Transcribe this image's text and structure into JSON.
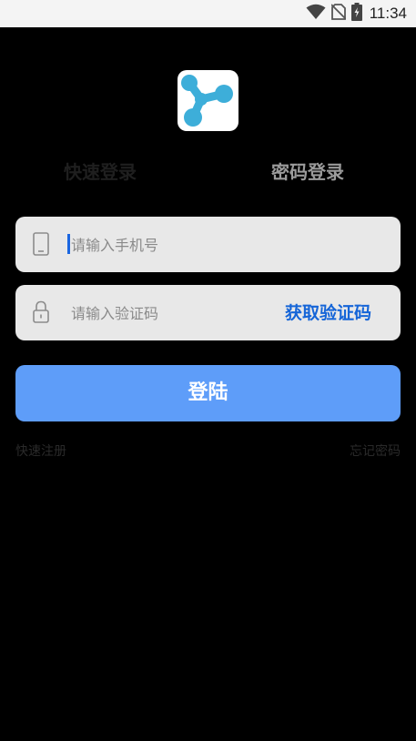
{
  "status_bar": {
    "time": "11:34",
    "icons": [
      "wifi-icon",
      "no-sim-icon",
      "battery-charging-icon"
    ]
  },
  "logo": {
    "icon": "molecule-logo-icon"
  },
  "tabs": {
    "quick_login": "快速登录",
    "password_login": "密码登录"
  },
  "phone_field": {
    "placeholder": "请输入手机号",
    "icon": "phone-icon"
  },
  "code_field": {
    "placeholder": "请输入验证码",
    "icon": "lock-icon",
    "get_code_label": "获取验证码"
  },
  "login_button": {
    "label": "登陆"
  },
  "links": {
    "register": "快速注册",
    "forgot_password": "忘记密码"
  },
  "colors": {
    "accent": "#5e9df9",
    "link_blue": "#1565d8",
    "logo_blue": "#3daed9",
    "background": "#000000",
    "field_bg": "#e8e8e8"
  }
}
